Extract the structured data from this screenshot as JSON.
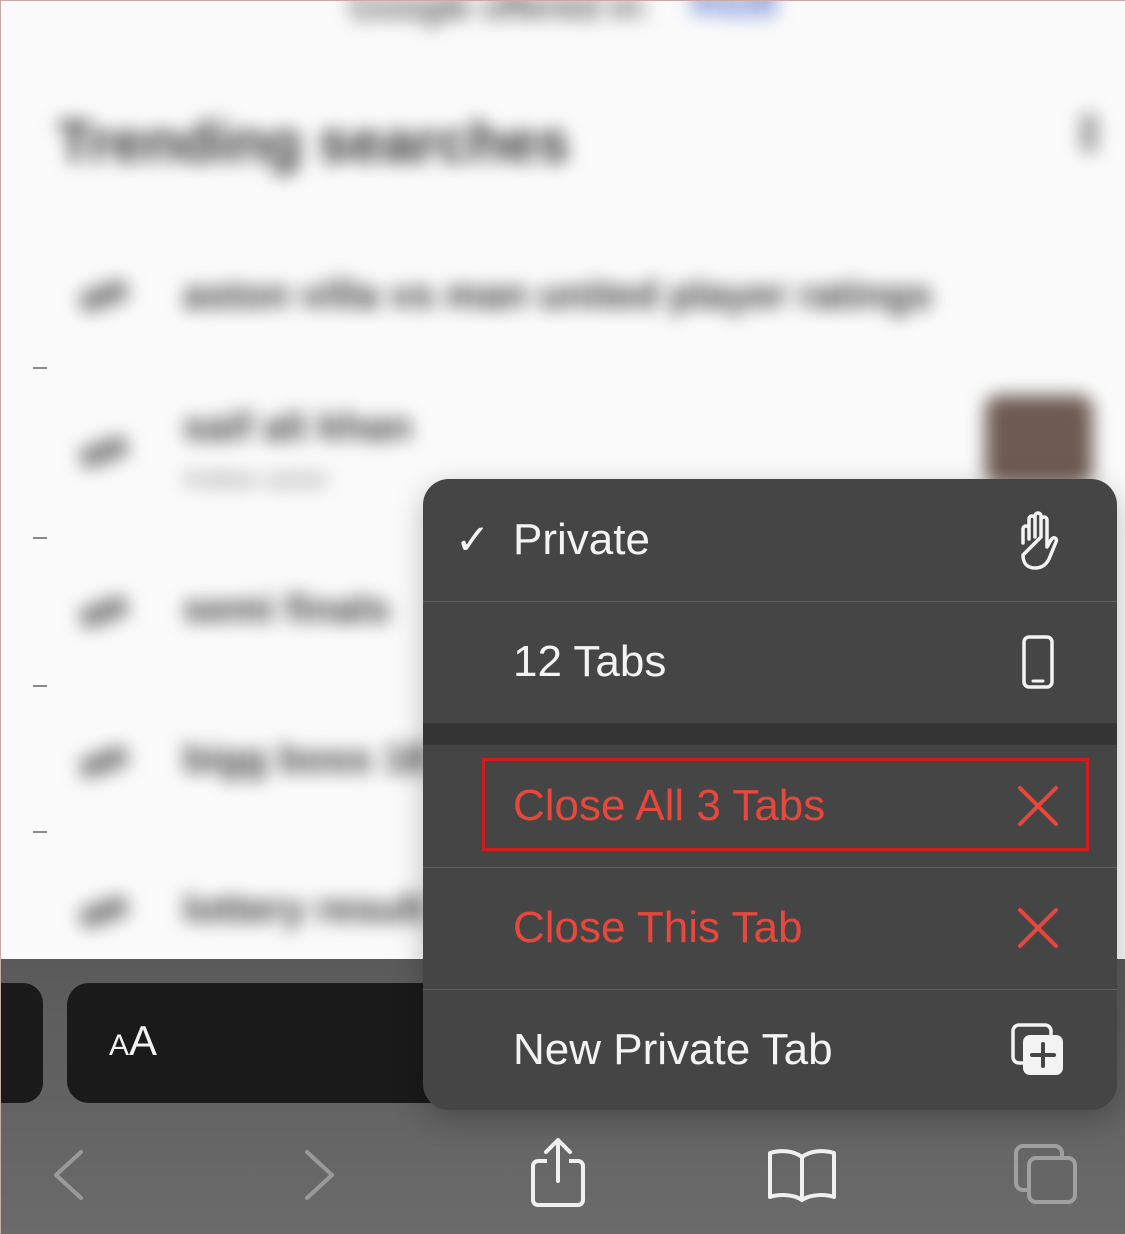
{
  "page": {
    "offered_in": "Google offered in:",
    "offered_lang": "नेपाली",
    "trending_title": "Trending searches",
    "trending": [
      {
        "text": "aston villa vs man united player ratings",
        "sub": ""
      },
      {
        "text": "saif ali khan",
        "sub": "Indian actor"
      },
      {
        "text": "semi finals",
        "sub": ""
      },
      {
        "text": "bigg boss 18",
        "sub": ""
      },
      {
        "text": "lottery result",
        "sub": ""
      }
    ]
  },
  "menu": {
    "items": [
      {
        "label": "Private",
        "checked": true,
        "icon": "hand-icon",
        "color": "#f3f3f3"
      },
      {
        "label": "12 Tabs",
        "icon": "phone-icon",
        "color": "#f3f3f3"
      },
      {
        "label": "Close All 3 Tabs",
        "icon": "close-icon",
        "color": "#e8473c",
        "highlighted": true
      },
      {
        "label": "Close This Tab",
        "icon": "close-icon",
        "color": "#e8473c"
      },
      {
        "label": "New Private Tab",
        "icon": "new-tab-icon",
        "color": "#f3f3f3"
      }
    ],
    "checkmark": "✓",
    "highlight_color": "#d01c1c"
  },
  "toolbar": {
    "aa_small": "A",
    "aa_big": "A",
    "buttons": [
      "back-icon",
      "forward-icon",
      "share-icon",
      "bookmarks-icon",
      "tabs-icon"
    ]
  }
}
